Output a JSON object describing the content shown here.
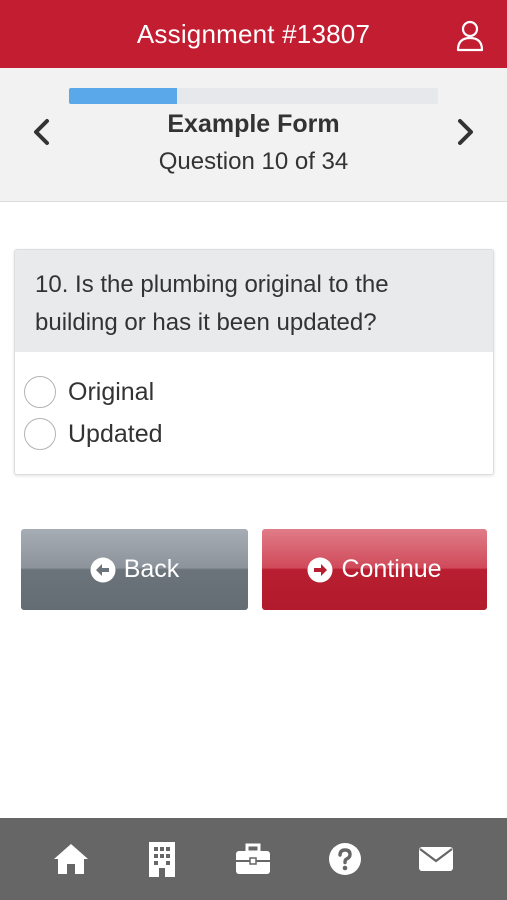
{
  "topbar": {
    "title": "Assignment #13807",
    "user_icon": "user-icon"
  },
  "header": {
    "form_name": "Example Form",
    "question_counter": "Question 10 of 34",
    "progress_fraction": 0.294,
    "prev_icon": "chevron-left-icon",
    "next_icon": "chevron-right-icon"
  },
  "question": {
    "text": "10. Is the plumbing original to the building or has it been updated?",
    "options": [
      {
        "label": "Original",
        "selected": false
      },
      {
        "label": "Updated",
        "selected": false
      }
    ]
  },
  "buttons": {
    "back_label": "Back",
    "continue_label": "Continue",
    "back_icon": "arrow-left-circle-icon",
    "continue_icon": "arrow-right-circle-icon"
  },
  "footer": {
    "icons": [
      "home-icon",
      "building-icon",
      "briefcase-icon",
      "help-icon",
      "envelope-icon"
    ]
  },
  "colors": {
    "brand_red": "#c21d31",
    "progress_blue": "#5aa7ea",
    "footer_gray": "#666666",
    "back_gray": "#6b737b"
  }
}
